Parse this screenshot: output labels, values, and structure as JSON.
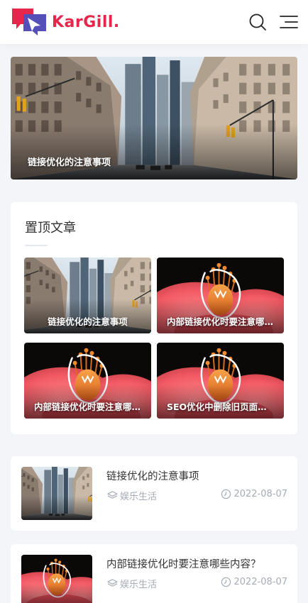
{
  "brand": {
    "name": "KarGill.",
    "logo_icon": "chat-bubble-arrow-logo",
    "color": "#e6264b"
  },
  "header": {
    "search_icon": "search-icon",
    "menu_icon": "hamburger-menu-icon"
  },
  "hero": {
    "title": "链接优化的注意事项",
    "image": "city-street-photo"
  },
  "pinned": {
    "heading": "置顶文章",
    "cards": [
      {
        "title": "链接优化的注意事项",
        "image": "city-street-photo"
      },
      {
        "title": "内部链接优化时要注意哪些内容？",
        "image": "flower-macro-photo"
      },
      {
        "title": "内部链接优化时要注意哪些内容？",
        "image": "flower-macro-photo"
      },
      {
        "title": "SEO优化中删除旧页面需要注意什么？",
        "image": "flower-macro-photo"
      }
    ]
  },
  "articles": [
    {
      "title": "链接优化的注意事项",
      "category": "娱乐生活",
      "date": "2022-08-07",
      "image": "city-street-photo"
    },
    {
      "title": "内部链接优化时要注意哪些内容？",
      "category": "娱乐生活",
      "date": "2022-08-07",
      "image": "flower-macro-photo"
    }
  ],
  "colors": {
    "background": "#f3f5f9",
    "meta_text": "#a5abb6",
    "title_text": "#333333"
  }
}
